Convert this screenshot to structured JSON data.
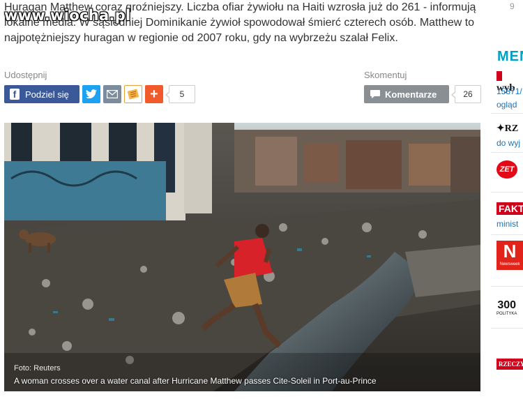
{
  "article": {
    "lead": "Huragan Matthew coraz groźniejszy. Liczba ofiar żywiołu na Haiti wzrosła już do 261 - informują lokalne media. W sąsiedniej Dominikanie żywioł spowodował śmierć czterech osób. Matthew to najpotężniejszy huragan w regionie od 2007 roku, gdy na wybrzeżu szalał Felix."
  },
  "watermark": "www.wiocha.pl",
  "corner_number": "9",
  "share": {
    "label": "Udostępnij",
    "facebook_label": "Podziel się",
    "count": "5",
    "icons": [
      "facebook-icon",
      "twitter-icon",
      "mail-icon",
      "wykop-icon",
      "plus-icon"
    ]
  },
  "comments": {
    "label": "Skomentuj",
    "button_label": "Komentarze",
    "count": "26"
  },
  "photo": {
    "source": "Foto: Reuters",
    "caption": "A woman crosses over a water canal after Hurricane Matthew passes Cite-Soleil in Port-au-Prince"
  },
  "sidebar": {
    "heading": "MEN",
    "items": [
      {
        "logo": "wyb",
        "line1": "15871/",
        "line2": "ogląd"
      },
      {
        "logo": "RZ",
        "line1": "do wyj"
      },
      {
        "logo": "ZET"
      },
      {
        "logo": "FAKT",
        "line1": "minist"
      },
      {
        "logo": "N",
        "sub": "Newsweek"
      },
      {
        "logo": "300",
        "sub": "POLITYKA"
      },
      {
        "logo": "RZECZY"
      }
    ]
  },
  "colors": {
    "facebook": "#3b5998",
    "twitter": "#1da1f2",
    "mail": "#7a8c9e",
    "plus": "#f15a2b",
    "comment_button": "#8a8f94",
    "sidebar_heading": "#00a0c6",
    "link": "#1a73b8"
  }
}
